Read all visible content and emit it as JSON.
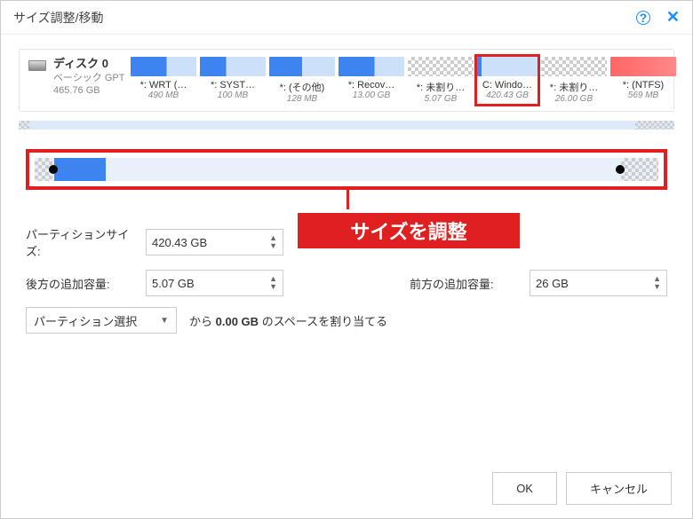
{
  "titlebar": {
    "title": "サイズ調整/移動"
  },
  "disk": {
    "name": "ディスク 0",
    "type": "ベーシック GPT",
    "size": "465.76 GB"
  },
  "partitions": [
    {
      "label": "*: WRT (…",
      "size": "490 MB",
      "style": "blue"
    },
    {
      "label": "*: SYST…",
      "size": "100 MB",
      "style": "blue-small"
    },
    {
      "label": "*: (その他)",
      "size": "128 MB",
      "style": "blue-med"
    },
    {
      "label": "*: Recov…",
      "size": "13.00 GB",
      "style": "blue"
    },
    {
      "label": "*: 未割り…",
      "size": "5.07 GB",
      "style": "hatched"
    },
    {
      "label": "C: Windo…",
      "size": "420.43 GB",
      "style": "blue-thin",
      "highlighted": true
    },
    {
      "label": "*: 未割り…",
      "size": "26.00 GB",
      "style": "hatched"
    },
    {
      "label": "*: (NTFS)",
      "size": "569 MB",
      "style": "red"
    }
  ],
  "callout": "サイズを調整",
  "form": {
    "partition_size_label": "パーティションサイズ:",
    "partition_size_value": "420.43 GB",
    "space_after_label": "後方の追加容量:",
    "space_after_value": "5.07 GB",
    "space_before_label": "前方の追加容量:",
    "space_before_value": "26 GB",
    "select_placeholder": "パーティション選択",
    "alloc_prefix": "から",
    "alloc_value": "0.00 GB",
    "alloc_suffix": "のスペースを割り当てる"
  },
  "buttons": {
    "ok": "OK",
    "cancel": "キャンセル"
  }
}
